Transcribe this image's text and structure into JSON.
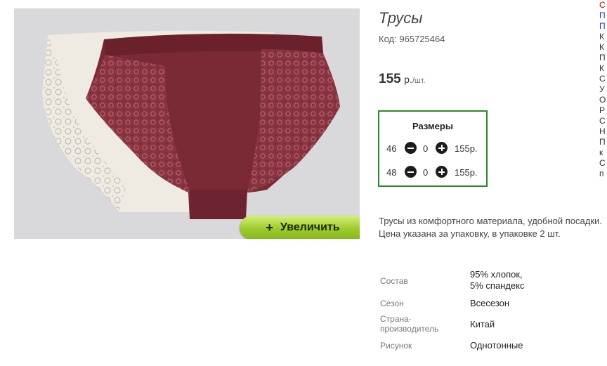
{
  "product": {
    "title": "Трусы",
    "code_label": "Код:",
    "code_value": "965725464",
    "price_value": "155",
    "price_currency": "р.",
    "price_unit": "/шт.",
    "zoom_button_label": "Увеличить",
    "zoom_button_icon": "plus-icon"
  },
  "sizes": {
    "heading": "Размеры",
    "rows": [
      {
        "size": "46",
        "qty": "0",
        "price": "155р."
      },
      {
        "size": "48",
        "qty": "0",
        "price": "155р."
      }
    ]
  },
  "description": "Трусы из комфортного материала, удобной посадки. Цена указана за упаковку, в упаковке 2 шт.",
  "attributes": [
    {
      "key": "Состав",
      "value_line1": "95% хлопок,",
      "value_line2": "5% спандекс"
    },
    {
      "key": "Сезон",
      "value": "Всесезон"
    },
    {
      "key_line1": "Страна-",
      "key_line2": "производитель",
      "value": "Китай"
    },
    {
      "key": "Рисунок",
      "value": "Однотонные"
    }
  ],
  "sidebar_fragments": [
    "С",
    "П",
    "П",
    "К",
    "К",
    "П",
    "К",
    "С",
    "У",
    "О",
    "Р",
    "С",
    "Н",
    "П",
    "к",
    "С",
    "п"
  ],
  "colors": {
    "sizes_border": "#2a8a2a",
    "zoom_button": "#9ccb2c",
    "product_fabric": "#7a2a35",
    "sidebar_link": "#1a3fb0",
    "sidebar_highlight": "#cc0000"
  }
}
